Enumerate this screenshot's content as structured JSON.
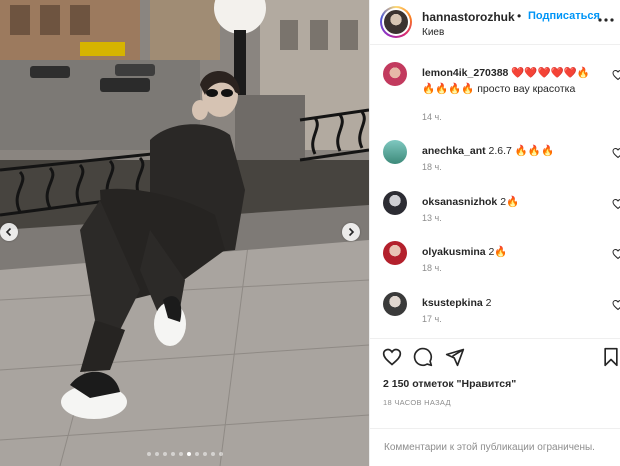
{
  "post": {
    "username": "hannastorozhuk",
    "separator": "•",
    "follow_label": "Подписаться",
    "location": "Киев",
    "more_icon": "more-horizontal-icon"
  },
  "carousel": {
    "total_slides": 10,
    "active_slide": 6,
    "prev_icon": "chevron-left-icon",
    "next_icon": "chevron-right-icon"
  },
  "comments": [
    {
      "username": "lemon4ik_270388",
      "text": " ❤️❤️❤️❤️❤️🔥🔥🔥🔥🔥 просто вау красотка",
      "time": "14 ч."
    },
    {
      "username": "anechka_ant",
      "text": " 2.6.7 🔥🔥🔥",
      "time": "18 ч."
    },
    {
      "username": "oksanasnizhok",
      "text": " 2🔥",
      "time": "13 ч."
    },
    {
      "username": "olyakusmina",
      "text": " 2🔥",
      "time": "18 ч."
    },
    {
      "username": "ksustepkina",
      "text": " 2",
      "time": "17 ч."
    }
  ],
  "actions": {
    "like_icon": "heart-icon",
    "comment_icon": "comment-icon",
    "share_icon": "send-icon",
    "save_icon": "bookmark-icon"
  },
  "likes_text": "2 150 отметок \"Нравится\"",
  "time_ago": "18 ЧАСОВ НАЗАД",
  "comments_limited": "Комментарии к этой публикации ограничены."
}
